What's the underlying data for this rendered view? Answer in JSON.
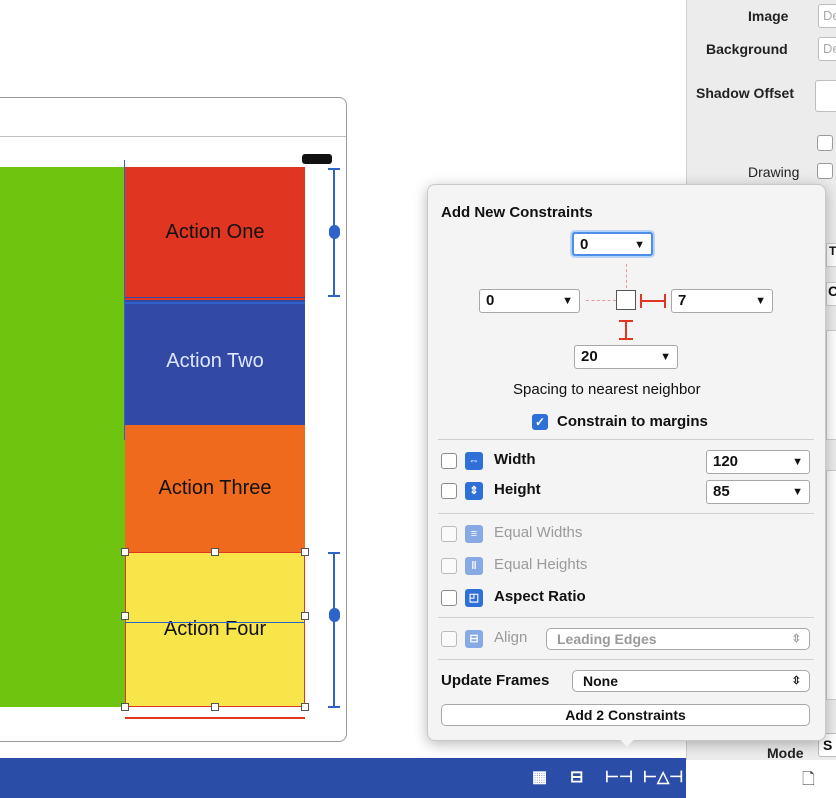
{
  "inspector": {
    "image_label": "Image",
    "image_placeholder": "De",
    "background_label": "Background",
    "background_placeholder": "De",
    "shadow_offset_label": "Shadow Offset",
    "drawing_label": "Drawing",
    "mode_label": "Mode",
    "mode_value": "S",
    "edge_fragments": [
      "Ti",
      "C"
    ]
  },
  "canvas": {
    "action_one": "Action One",
    "action_two": "Action Two",
    "action_three": "Action Three",
    "action_four": "Action Four"
  },
  "popover": {
    "title": "Add New Constraints",
    "top_value": "0",
    "leading_value": "0",
    "trailing_value": "7",
    "bottom_value": "20",
    "spacing_caption": "Spacing to nearest neighbor",
    "constrain_margins_label": "Constrain to margins",
    "constrain_margins_checked": true,
    "width_label": "Width",
    "width_value": "120",
    "height_label": "Height",
    "height_value": "85",
    "equal_widths_label": "Equal Widths",
    "equal_heights_label": "Equal Heights",
    "aspect_ratio_label": "Aspect Ratio",
    "align_label": "Align",
    "align_value": "Leading Edges",
    "update_frames_label": "Update Frames",
    "update_frames_value": "None",
    "add_button_label": "Add 2 Constraints"
  },
  "bottom_bar": {
    "icons": [
      "embed-stack-icon",
      "align-icon",
      "pin-icon",
      "resolve-issues-icon"
    ]
  },
  "colors": {
    "green": "#6fc40f",
    "red": "#e03520",
    "blue": "#3349a6",
    "orange": "#ef6a1d",
    "yellow": "#f7e54a",
    "bar_blue": "#2a4ea8",
    "accent": "#2f6fd8"
  }
}
